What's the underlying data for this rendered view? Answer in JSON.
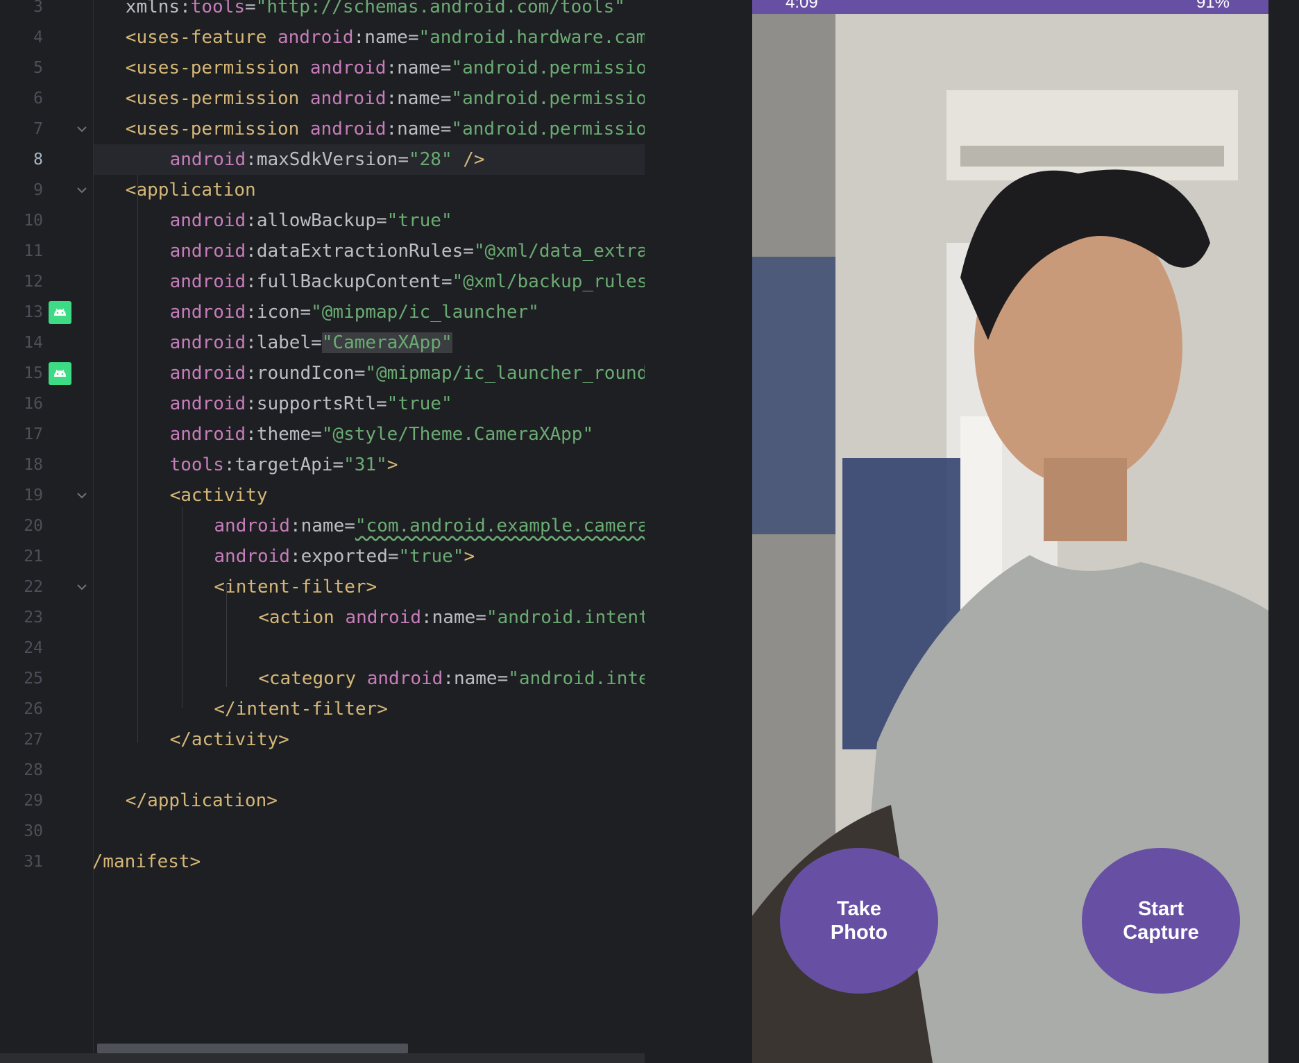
{
  "editor": {
    "lines": [
      {
        "n": "3",
        "segs": [
          [
            "attr",
            "xmlns"
          ],
          [
            "punct",
            ":"
          ],
          [
            "ns",
            "tools"
          ],
          [
            "punct",
            "="
          ],
          [
            "str",
            "\"http://schemas.android.com/tools\""
          ]
        ]
      },
      {
        "n": "4",
        "segs": [
          [
            "tag",
            "<uses-feature "
          ],
          [
            "ns",
            "android"
          ],
          [
            "punct",
            ":"
          ],
          [
            "attr",
            "name"
          ],
          [
            "punct",
            "="
          ],
          [
            "str",
            "\"android.hardware.camera.any\""
          ]
        ]
      },
      {
        "n": "5",
        "segs": [
          [
            "tag",
            "<uses-permission "
          ],
          [
            "ns",
            "android"
          ],
          [
            "punct",
            ":"
          ],
          [
            "attr",
            "name"
          ],
          [
            "punct",
            "="
          ],
          [
            "str",
            "\"android.permission.CAMERA\""
          ]
        ]
      },
      {
        "n": "6",
        "segs": [
          [
            "tag",
            "<uses-permission "
          ],
          [
            "ns",
            "android"
          ],
          [
            "punct",
            ":"
          ],
          [
            "attr",
            "name"
          ],
          [
            "punct",
            "="
          ],
          [
            "str",
            "\"android.permission.RECORD_AUDIO\""
          ]
        ]
      },
      {
        "n": "7",
        "segs": [
          [
            "tag",
            "<uses-permission "
          ],
          [
            "ns",
            "android"
          ],
          [
            "punct",
            ":"
          ],
          [
            "attr",
            "name"
          ],
          [
            "punct",
            "="
          ],
          [
            "str",
            "\"android.permission.WRITE_EXTERNAL_STORAGE\""
          ]
        ]
      },
      {
        "n": "8",
        "segs": [
          [
            "ns",
            "android"
          ],
          [
            "punct",
            ":"
          ],
          [
            "attr",
            "maxSdkVersion"
          ],
          [
            "punct",
            "="
          ],
          [
            "str",
            "\"28\""
          ],
          [
            "tag",
            " />"
          ]
        ]
      },
      {
        "n": "9",
        "segs": [
          [
            "tag",
            "<application"
          ]
        ]
      },
      {
        "n": "10",
        "segs": [
          [
            "ns",
            "android"
          ],
          [
            "punct",
            ":"
          ],
          [
            "attr",
            "allowBackup"
          ],
          [
            "punct",
            "="
          ],
          [
            "str",
            "\"true\""
          ]
        ]
      },
      {
        "n": "11",
        "segs": [
          [
            "ns",
            "android"
          ],
          [
            "punct",
            ":"
          ],
          [
            "attr",
            "dataExtractionRules"
          ],
          [
            "punct",
            "="
          ],
          [
            "str",
            "\"@xml/data_extraction_rules\""
          ]
        ]
      },
      {
        "n": "12",
        "segs": [
          [
            "ns",
            "android"
          ],
          [
            "punct",
            ":"
          ],
          [
            "attr",
            "fullBackupContent"
          ],
          [
            "punct",
            "="
          ],
          [
            "str",
            "\"@xml/backup_rules\""
          ]
        ]
      },
      {
        "n": "13",
        "segs": [
          [
            "ns",
            "android"
          ],
          [
            "punct",
            ":"
          ],
          [
            "attr",
            "icon"
          ],
          [
            "punct",
            "="
          ],
          [
            "str",
            "\"@mipmap/ic_launcher\""
          ]
        ]
      },
      {
        "n": "14",
        "segs": [
          [
            "ns",
            "android"
          ],
          [
            "punct",
            ":"
          ],
          [
            "attr",
            "label"
          ],
          [
            "punct",
            "="
          ],
          [
            "sel",
            "\"CameraXApp\""
          ]
        ]
      },
      {
        "n": "15",
        "segs": [
          [
            "ns",
            "android"
          ],
          [
            "punct",
            ":"
          ],
          [
            "attr",
            "roundIcon"
          ],
          [
            "punct",
            "="
          ],
          [
            "str",
            "\"@mipmap/ic_launcher_round\""
          ]
        ]
      },
      {
        "n": "16",
        "segs": [
          [
            "ns",
            "android"
          ],
          [
            "punct",
            ":"
          ],
          [
            "attr",
            "supportsRtl"
          ],
          [
            "punct",
            "="
          ],
          [
            "str",
            "\"true\""
          ]
        ]
      },
      {
        "n": "17",
        "segs": [
          [
            "ns",
            "android"
          ],
          [
            "punct",
            ":"
          ],
          [
            "attr",
            "theme"
          ],
          [
            "punct",
            "="
          ],
          [
            "str",
            "\"@style/Theme.CameraXApp\""
          ]
        ]
      },
      {
        "n": "18",
        "segs": [
          [
            "ns",
            "tools"
          ],
          [
            "punct",
            ":"
          ],
          [
            "attr",
            "targetApi"
          ],
          [
            "punct",
            "="
          ],
          [
            "str",
            "\"31\""
          ],
          [
            "tag",
            ">"
          ]
        ]
      },
      {
        "n": "19",
        "segs": [
          [
            "tag",
            "<activity"
          ]
        ]
      },
      {
        "n": "20",
        "segs": [
          [
            "ns",
            "android"
          ],
          [
            "punct",
            ":"
          ],
          [
            "attr",
            "name"
          ],
          [
            "punct",
            "="
          ],
          [
            "str",
            "\"com.android.example.cameraxapp.MainActivity\""
          ]
        ]
      },
      {
        "n": "21",
        "segs": [
          [
            "ns",
            "android"
          ],
          [
            "punct",
            ":"
          ],
          [
            "attr",
            "exported"
          ],
          [
            "punct",
            "="
          ],
          [
            "str",
            "\"true\""
          ],
          [
            "tag",
            ">"
          ]
        ]
      },
      {
        "n": "22",
        "segs": [
          [
            "tag",
            "<intent-filter>"
          ]
        ]
      },
      {
        "n": "23",
        "segs": [
          [
            "tag",
            "<action "
          ],
          [
            "ns",
            "android"
          ],
          [
            "punct",
            ":"
          ],
          [
            "attr",
            "name"
          ],
          [
            "punct",
            "="
          ],
          [
            "str",
            "\"android.intent.action.MAIN\""
          ],
          [
            "tag",
            " />"
          ]
        ]
      },
      {
        "n": "24",
        "segs": []
      },
      {
        "n": "25",
        "segs": [
          [
            "tag",
            "<category "
          ],
          [
            "ns",
            "android"
          ],
          [
            "punct",
            ":"
          ],
          [
            "attr",
            "name"
          ],
          [
            "punct",
            "="
          ],
          [
            "str",
            "\"android.intent.category.LAUNCHER\""
          ],
          [
            "tag",
            " />"
          ]
        ]
      },
      {
        "n": "26",
        "segs": [
          [
            "tag",
            "</intent-filter>"
          ]
        ]
      },
      {
        "n": "27",
        "segs": [
          [
            "tag",
            "</activity>"
          ]
        ]
      },
      {
        "n": "28",
        "segs": []
      },
      {
        "n": "29",
        "segs": [
          [
            "tag",
            "</application>"
          ]
        ]
      },
      {
        "n": "30",
        "segs": []
      },
      {
        "n": "31",
        "segs": [
          [
            "tag",
            "</manifest>"
          ]
        ]
      }
    ]
  },
  "phone": {
    "status_time": "4:09",
    "status_right": "91%",
    "buttons": {
      "take_photo": "Take\nPhoto",
      "start_capture": "Start\nCapture"
    },
    "accent_color": "#6750a4"
  }
}
